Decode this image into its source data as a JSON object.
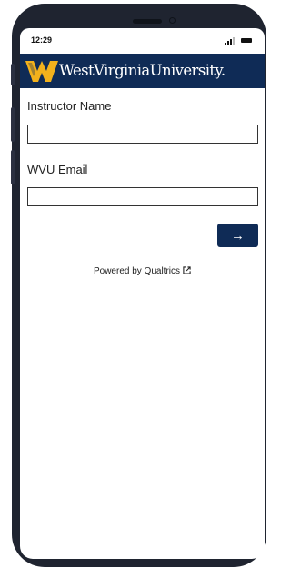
{
  "status_bar": {
    "time": "12:29",
    "signal_icon": "signal-icon",
    "battery_icon": "battery-icon"
  },
  "header": {
    "logo_icon": "wvu-flying-wv-logo",
    "logo_text": "WestVirginiaUniversity.",
    "background_color": "#0f2b56",
    "logo_color": "#f2b11c"
  },
  "form": {
    "instructor_name": {
      "label": "Instructor Name",
      "value": ""
    },
    "wvu_email": {
      "label": "WVU Email",
      "value": ""
    },
    "next_button": {
      "label": "→",
      "color": "#0f2b56"
    }
  },
  "footer": {
    "powered_by": "Powered by Qualtrics",
    "external_link_icon": "external-link-icon"
  }
}
